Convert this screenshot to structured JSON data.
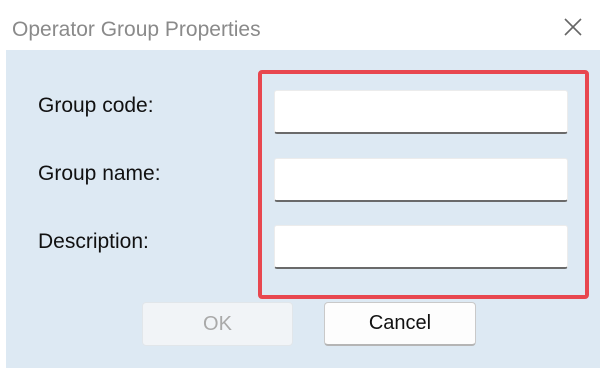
{
  "window": {
    "title": "Operator Group Properties"
  },
  "form": {
    "fields": [
      {
        "label": "Group code:",
        "value": "",
        "placeholder": ""
      },
      {
        "label": "Group name:",
        "value": "",
        "placeholder": ""
      },
      {
        "label": "Description:",
        "value": "",
        "placeholder": ""
      }
    ]
  },
  "buttons": {
    "ok_label": "OK",
    "cancel_label": "Cancel"
  },
  "icons": {
    "close": "close-icon"
  },
  "colors": {
    "dialog_background": "#dde9f3",
    "highlight_border": "#e8474f",
    "title_text": "#8a8a8a",
    "disabled_text": "#a9a9a9"
  }
}
